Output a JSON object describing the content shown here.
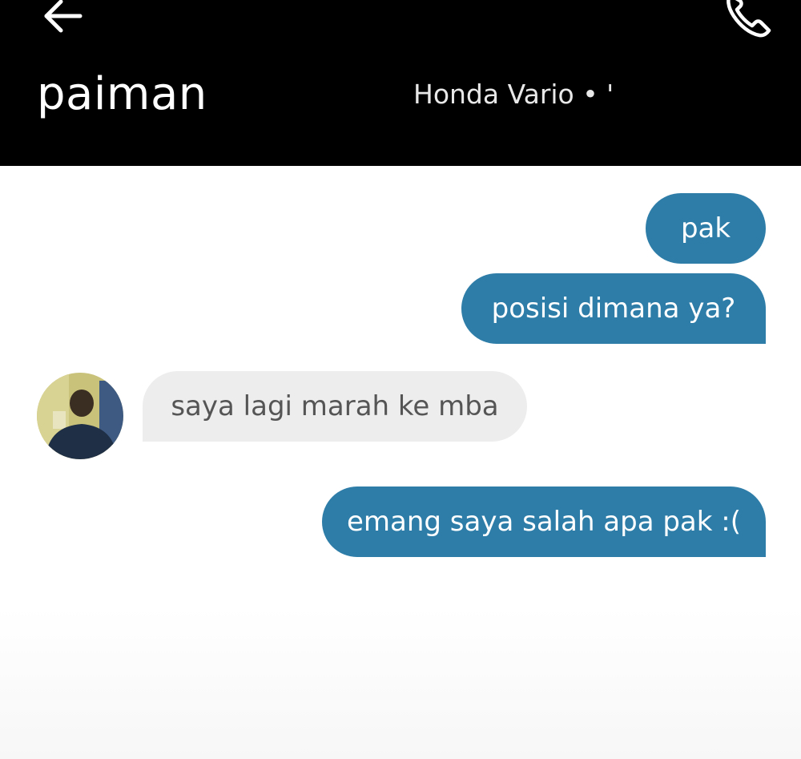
{
  "header": {
    "driver_name": "paiman",
    "vehicle_info": "Honda Vario • '",
    "back_icon": "arrow-left-icon",
    "call_icon": "phone-icon",
    "background_color": "#000000"
  },
  "messages": [
    {
      "sender": "user",
      "text": "pak"
    },
    {
      "sender": "user",
      "text": "posisi dimana ya?"
    },
    {
      "sender": "driver",
      "text": "saya lagi marah ke mba"
    },
    {
      "sender": "user",
      "text": "emang saya salah apa pak :("
    }
  ],
  "colors": {
    "outgoing_bubble": "#2d7da8",
    "incoming_bubble": "#ededed",
    "incoming_text": "#555555"
  }
}
